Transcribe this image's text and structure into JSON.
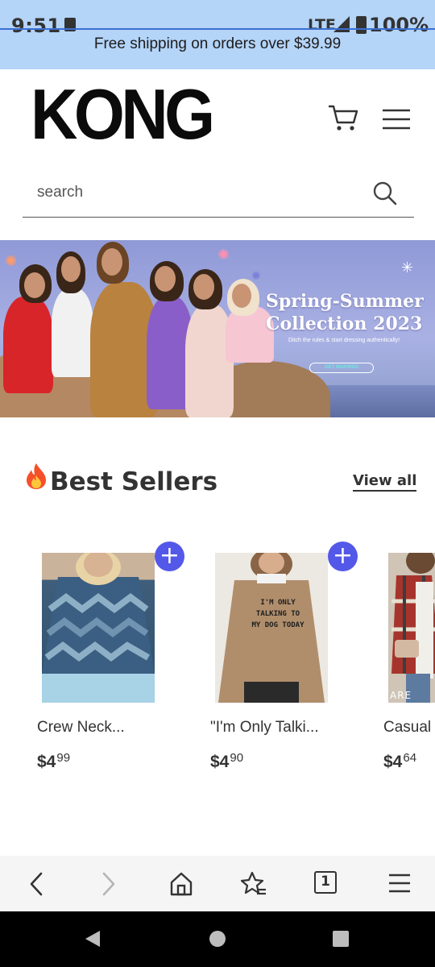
{
  "status_bar": {
    "time": "9:51",
    "network": "LTE",
    "battery": "100%"
  },
  "promo_bar": {
    "text": "Free shipping on orders over $39.99"
  },
  "header": {
    "logo": "KONG",
    "icons": [
      "cart-icon",
      "menu-icon"
    ]
  },
  "search": {
    "placeholder": "search"
  },
  "banner": {
    "title": "Spring-Summer Collection 2023",
    "subtitle": "Ditch the rules & start dressing authentically!",
    "cta": "GET INSPIRED"
  },
  "best_sellers": {
    "title": "Best Sellers",
    "view_all": "View all",
    "products": [
      {
        "name": "Crew Neck...",
        "price_main": "$4",
        "price_cents": "99",
        "image_text": ""
      },
      {
        "name": "\"I'm Only Talki...",
        "price_main": "$4",
        "price_cents": "90",
        "image_text": "I'M ONLY TALKING TO MY DOG TODAY"
      },
      {
        "name": "Casual",
        "price_main": "$4",
        "price_cents": "64",
        "image_text": "ARE"
      }
    ]
  },
  "browser_bar": {
    "tab_count": "1",
    "icons": [
      "back-icon",
      "forward-icon",
      "home-icon",
      "bookmark-star-icon",
      "tabs-icon",
      "menu-icon"
    ]
  },
  "colors": {
    "promo_bg": "#b4d4f8",
    "accent": "#5458e8",
    "text": "#333333"
  }
}
